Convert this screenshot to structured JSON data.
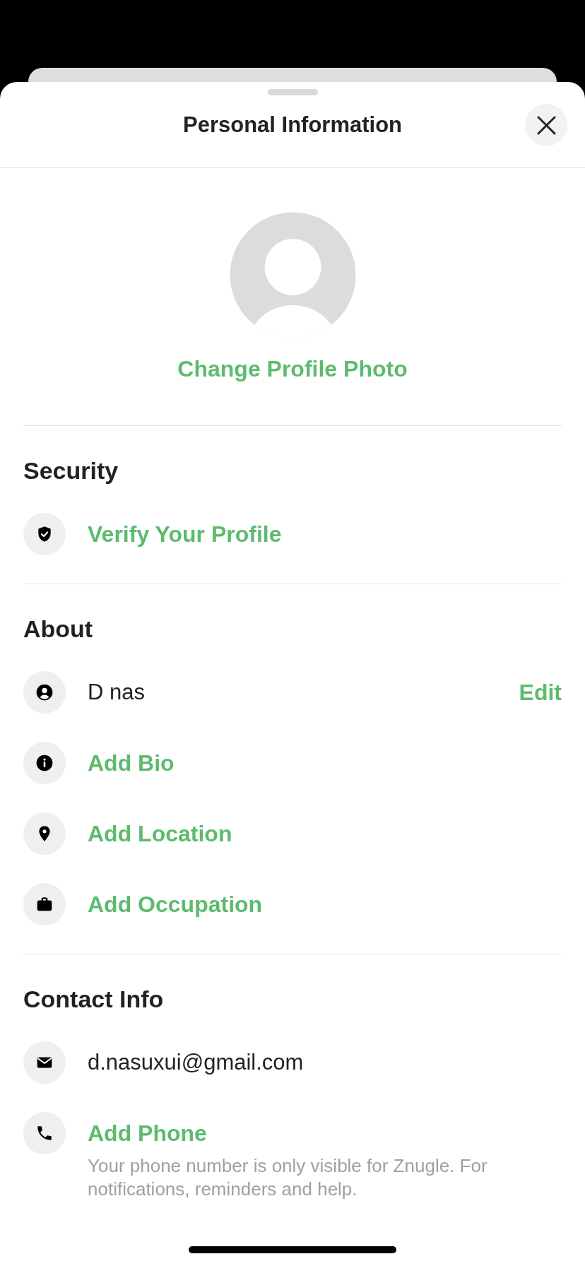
{
  "sheet": {
    "title": "Personal Information"
  },
  "profile_photo": {
    "action": "Change Profile Photo"
  },
  "sections": [
    {
      "title": "Security",
      "items": [
        {
          "kind": "link",
          "label": "Verify Your Profile"
        }
      ]
    },
    {
      "title": "About",
      "items": [
        {
          "kind": "value",
          "label": "D nas",
          "action": "Edit"
        },
        {
          "kind": "link",
          "label": "Add Bio"
        },
        {
          "kind": "link",
          "label": "Add Location"
        },
        {
          "kind": "link",
          "label": "Add Occupation"
        }
      ]
    },
    {
      "title": "Contact Info",
      "items": [
        {
          "kind": "value",
          "label": "d.nasuxui@gmail.com"
        },
        {
          "kind": "link",
          "label": "Add Phone",
          "note": "Your phone number is only visible for Znugle. For notifications, reminders and help."
        }
      ]
    }
  ]
}
